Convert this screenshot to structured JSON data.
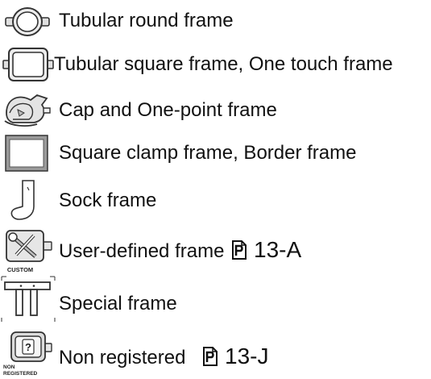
{
  "frames": [
    {
      "icon": "tubular-round-frame-icon",
      "label": "Tubular round frame"
    },
    {
      "icon": "tubular-square-frame-icon",
      "label": "Tubular square frame, One touch frame"
    },
    {
      "icon": "cap-frame-icon",
      "label": "Cap  and One-point frame"
    },
    {
      "icon": "square-clamp-frame-icon",
      "label": "Square clamp frame, Border frame"
    },
    {
      "icon": "sock-frame-icon",
      "label": "Sock frame"
    },
    {
      "icon": "user-defined-frame-icon",
      "icon_text": "CUSTOM",
      "label": "User-defined frame",
      "ref": "13-A"
    },
    {
      "icon": "special-frame-icon",
      "label": "Special frame"
    },
    {
      "icon": "non-registered-frame-icon",
      "icon_text": "NON REGISTERED",
      "label": "Non registered",
      "ref": "13-J"
    }
  ],
  "ref_icon": "page-reference-icon"
}
